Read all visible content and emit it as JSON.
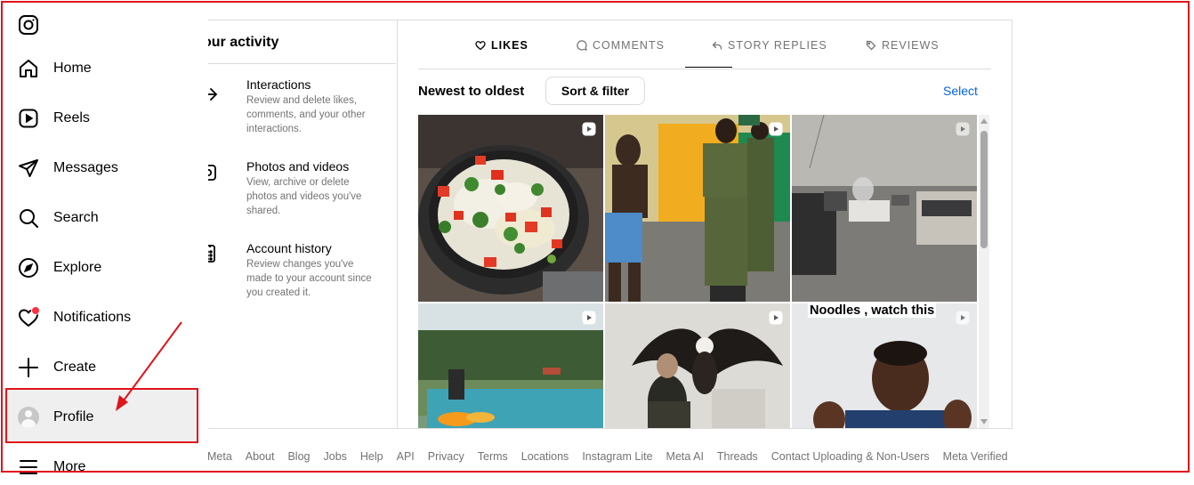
{
  "sidebar": {
    "items": [
      {
        "label": "Home",
        "icon": "home-icon"
      },
      {
        "label": "Reels",
        "icon": "reels-icon"
      },
      {
        "label": "Messages",
        "icon": "messages-icon"
      },
      {
        "label": "Search",
        "icon": "search-icon"
      },
      {
        "label": "Explore",
        "icon": "explore-icon"
      },
      {
        "label": "Notifications",
        "icon": "heart-icon"
      },
      {
        "label": "Create",
        "icon": "plus-icon"
      },
      {
        "label": "Profile",
        "icon": "avatar"
      },
      {
        "label": "More",
        "icon": "menu-icon"
      }
    ]
  },
  "activity": {
    "title": "our activity",
    "items": [
      {
        "title": "Interactions",
        "desc": "Review and delete likes, comments, and your other interactions."
      },
      {
        "title": "Photos and videos",
        "desc": "View, archive or delete photos and videos you've shared."
      },
      {
        "title": "Account history",
        "desc": "Review changes you've made to your account since you created it."
      }
    ]
  },
  "tabs": [
    {
      "label": "LIKES",
      "active": true
    },
    {
      "label": "COMMENTS",
      "active": false
    },
    {
      "label": "STORY REPLIES",
      "active": false
    },
    {
      "label": "REVIEWS",
      "active": false
    }
  ],
  "sort": {
    "label": "Newest to oldest",
    "button": "Sort & filter",
    "select": "Select"
  },
  "grid": {
    "overlay_text": "Noodles , watch this"
  },
  "footer": [
    "Meta",
    "About",
    "Blog",
    "Jobs",
    "Help",
    "API",
    "Privacy",
    "Terms",
    "Locations",
    "Instagram Lite",
    "Meta AI",
    "Threads",
    "Contact Uploading & Non-Users",
    "Meta Verified"
  ],
  "colors": {
    "accent": "#0064e0",
    "annotation_red": "#e0141b",
    "notification_dot": "#ff3040"
  }
}
